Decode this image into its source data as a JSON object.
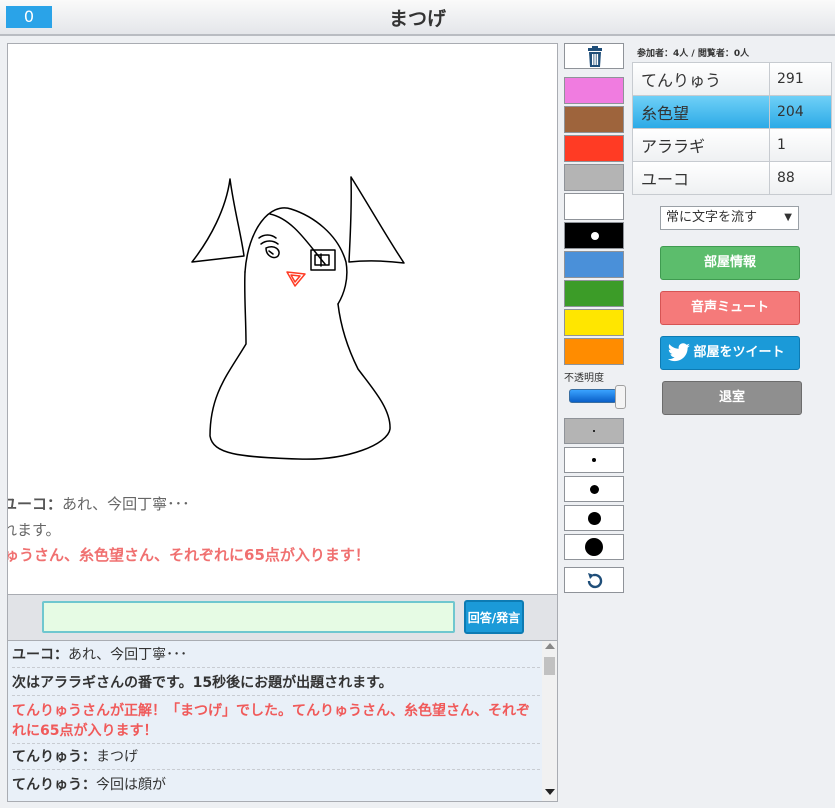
{
  "header": {
    "round": "0",
    "title": "まつげ"
  },
  "canvas_overlay": {
    "line1_speaker": "ユーコ：",
    "line1_text": "あれ、今回丁寧･･･",
    "line2": "れます。",
    "line3": "ゅうさん、糸色望さん、それぞれに65点が入ります！"
  },
  "input": {
    "value": "",
    "button_label": "回答/発言"
  },
  "chat": [
    {
      "speaker": "ユーコ：",
      "text": "あれ、今回丁寧･･･"
    },
    {
      "text": "次はアララギさんの番です。15秒後にお題が出題されます。"
    },
    {
      "line1": "てんりゅうさんが正解！「まつげ」でした。てんりゅうさん、糸色望さん、それぞ",
      "line2": "れに65点が入ります！"
    },
    {
      "speaker": "てんりゅう：",
      "text": "まつげ"
    },
    {
      "speaker": "てんりゅう：",
      "text": "今回は顔が"
    }
  ],
  "tools": {
    "colors": [
      "#f07ce0",
      "#9e643c",
      "#ff3b24",
      "#b4b4b4",
      "#ffffff",
      "#000000",
      "#4a90d9",
      "#3c9c28",
      "#ffe600",
      "#ff8c00"
    ],
    "selected_color": "#000000",
    "opacity_label": "不透明度",
    "opacity": 1.0,
    "brush_sizes": [
      2,
      4,
      9,
      13,
      18
    ],
    "selected_size": 2,
    "trash_icon": "trash-icon",
    "undo_icon": "undo-icon"
  },
  "room": {
    "stats": "参加者：4人 / 閲覧者：0人",
    "players": [
      {
        "name": "てんりゅう",
        "score": "291"
      },
      {
        "name": "糸色望",
        "score": "204"
      },
      {
        "name": "アララギ",
        "score": "1"
      },
      {
        "name": "ユーコ",
        "score": "88"
      }
    ],
    "active_player_index": 1,
    "flow_option": "常に文字を流す",
    "room_info_label": "部屋情報",
    "mute_label": "音声ミュート",
    "tweet_label": "部屋をツイート",
    "leave_label": "退室"
  }
}
